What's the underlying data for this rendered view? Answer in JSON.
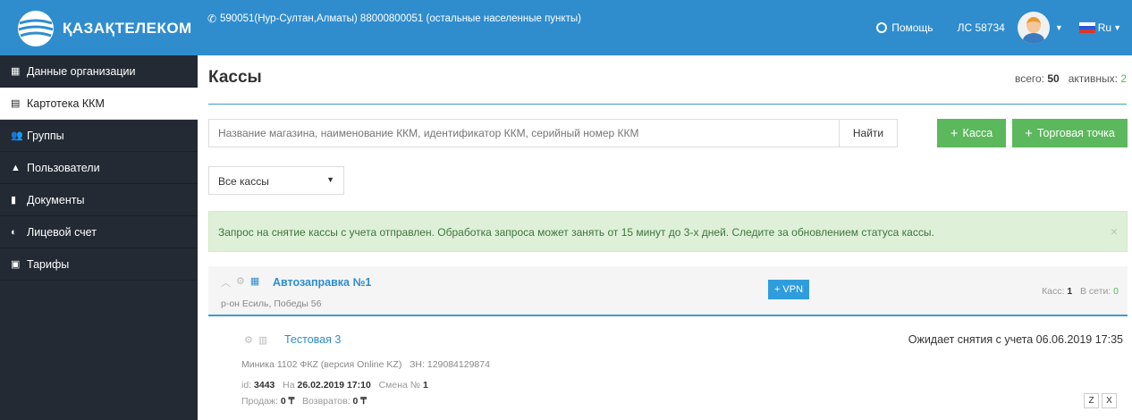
{
  "header": {
    "brand": "ҚАЗАҚТЕЛЕКОМ",
    "phone_text": "590051(Нур-Султан,Алматы) 88000800051 (остальные населенные пункты)",
    "help_label": "Помощь",
    "account_label": "ЛС 58734",
    "lang_label": "Ru",
    "accent_color": "#2f8dce"
  },
  "sidebar": {
    "items": [
      {
        "label": "Данные организации",
        "icon": "building-icon"
      },
      {
        "label": "Картотека ККМ",
        "icon": "calculator-icon"
      },
      {
        "label": "Группы",
        "icon": "users-icon"
      },
      {
        "label": "Пользователи",
        "icon": "user-icon"
      },
      {
        "label": "Документы",
        "icon": "document-icon"
      },
      {
        "label": "Лицевой счет",
        "icon": "wallet-icon"
      },
      {
        "label": "Тарифы",
        "icon": "tariff-icon"
      }
    ],
    "active_index": 1
  },
  "page": {
    "title": "Кассы",
    "total_label": "всего:",
    "total_value": "50",
    "active_label": "активных:",
    "active_value": "2"
  },
  "search": {
    "placeholder": "Название магазина, наименование ККМ, идентификатор ККМ, серийный номер ККМ",
    "find_label": "Найти"
  },
  "actions": {
    "add_kassa": "Касса",
    "add_point": "Торговая точка"
  },
  "filter": {
    "selected": "Все кассы"
  },
  "alert": {
    "text": "Запрос на снятие кассы с учета отправлен. Обработка запроса может занять от 15 минут до 3-х дней. Следите за обновлением статуса кассы.",
    "close": "×"
  },
  "group": {
    "name": "Автозаправка №1",
    "address": "р-он Есиль, Победы 56",
    "vpn_label": "VPN",
    "kass_label": "Касс:",
    "kass_value": "1",
    "online_label": "В сети:",
    "online_value": "0"
  },
  "kkm": {
    "name": "Тестовая 3",
    "status": "Ожидает снятия с учета 06.06.2019 17:35",
    "model": "Миника 1102 ФКZ (версия Online KZ)",
    "serial_label": "ЗН:",
    "serial_value": "129084129874",
    "id_label": "id:",
    "id_value": "3443",
    "on_label": "На",
    "on_value": "26.02.2019 17:10",
    "shift_label": "Смена №",
    "shift_value": "1",
    "sales_label": "Продаж:",
    "sales_value": "0 ₸",
    "returns_label": "Возвратов:",
    "returns_value": "0 ₸",
    "z_label": "Z",
    "x_label": "X"
  }
}
